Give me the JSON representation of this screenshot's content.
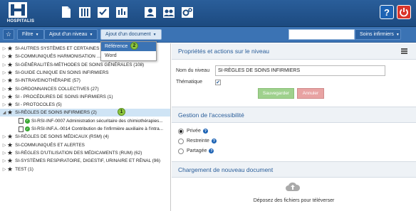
{
  "app": {
    "name": "HOSPITALIS"
  },
  "nav_icons": [
    "documents-icon",
    "library-icon",
    "checklist-icon",
    "revisions-icon",
    "users-icon",
    "group-icon",
    "settings-gears-icon"
  ],
  "toolbar": {
    "favorites_icon": "star-icon",
    "filter_label": "Filtre",
    "add_level_label": "Ajout d'un niveau",
    "add_document_label": "Ajout d'un document",
    "search_placeholder": "",
    "scope_label": "Soins infirmiers"
  },
  "dropdown": {
    "items": [
      "Référence",
      "Word"
    ],
    "highlighted": "Référence"
  },
  "callouts": {
    "one": "1",
    "two": "2"
  },
  "tree": {
    "items": [
      "SI-AUTRES SYSTÈMES ET CERTAINES T...",
      "SI-COMMUNIQUÉS HARMONISATION ... (3)",
      "SI-GÉNÉRALITÉS-MÉTHODES DE SOINS GÉNÉRALES (108)",
      "SI-GUIDE CLINIQUE EN SOINS INFIRMIERS",
      "SI-INTRAVEINOTHÉRAPIE (57)",
      "SI-ORDONNANCES COLLECTIVES (27)",
      "SI - PROCÉDURES DE SOINS INFIRMIERS (1)",
      "SI - PROTOCOLES (5)",
      "SI-RÈGLES DE SOINS INFIRMIERS (2)",
      "SI-RSI-INF-0007 Administration sécuritaire des chimiothérapies...",
      "SI-RSI-INF.A.-0014 Contribution de l'infirmière auxiliaire à l'intra...",
      "SI-RÈGLES DE SOINS MÉDICAUX (RSM) (4)",
      "SI-COMMUNIQUÉS ET ALERTES",
      "SI-RÈGLES D'UTILISATION DES MÉDICAMENTS (RUM) (62)",
      "SI-SYSTÈMES RESPIRATOIRE, DIGESTIF, URINAIRE ET RÉNAL (96)",
      "TEST (1)"
    ],
    "selected_index": 8
  },
  "properties": {
    "title": "Propriétés et actions sur le niveau",
    "level_name_label": "Nom du niveau",
    "level_name_value": "SI-RÈGLES DE SOINS INFIRMIERS",
    "thematic_label": "Thématique",
    "thematic_checked": true,
    "save_label": "Sauvegarder",
    "cancel_label": "Annuler"
  },
  "access": {
    "title": "Gestion de l'accessibilité",
    "options": [
      "Privée",
      "Restreinte",
      "Partagée"
    ],
    "selected": "Privée"
  },
  "upload": {
    "title": "Chargement de nouveau document",
    "drop_text": "Déposez des fichiers pour téléverser"
  },
  "colors": {
    "brand": "#2a5e9a",
    "toolbar": "#3b73b4",
    "selected_row": "#cfe4f5",
    "save": "#9fd18d",
    "cancel": "#e8a3a3"
  }
}
